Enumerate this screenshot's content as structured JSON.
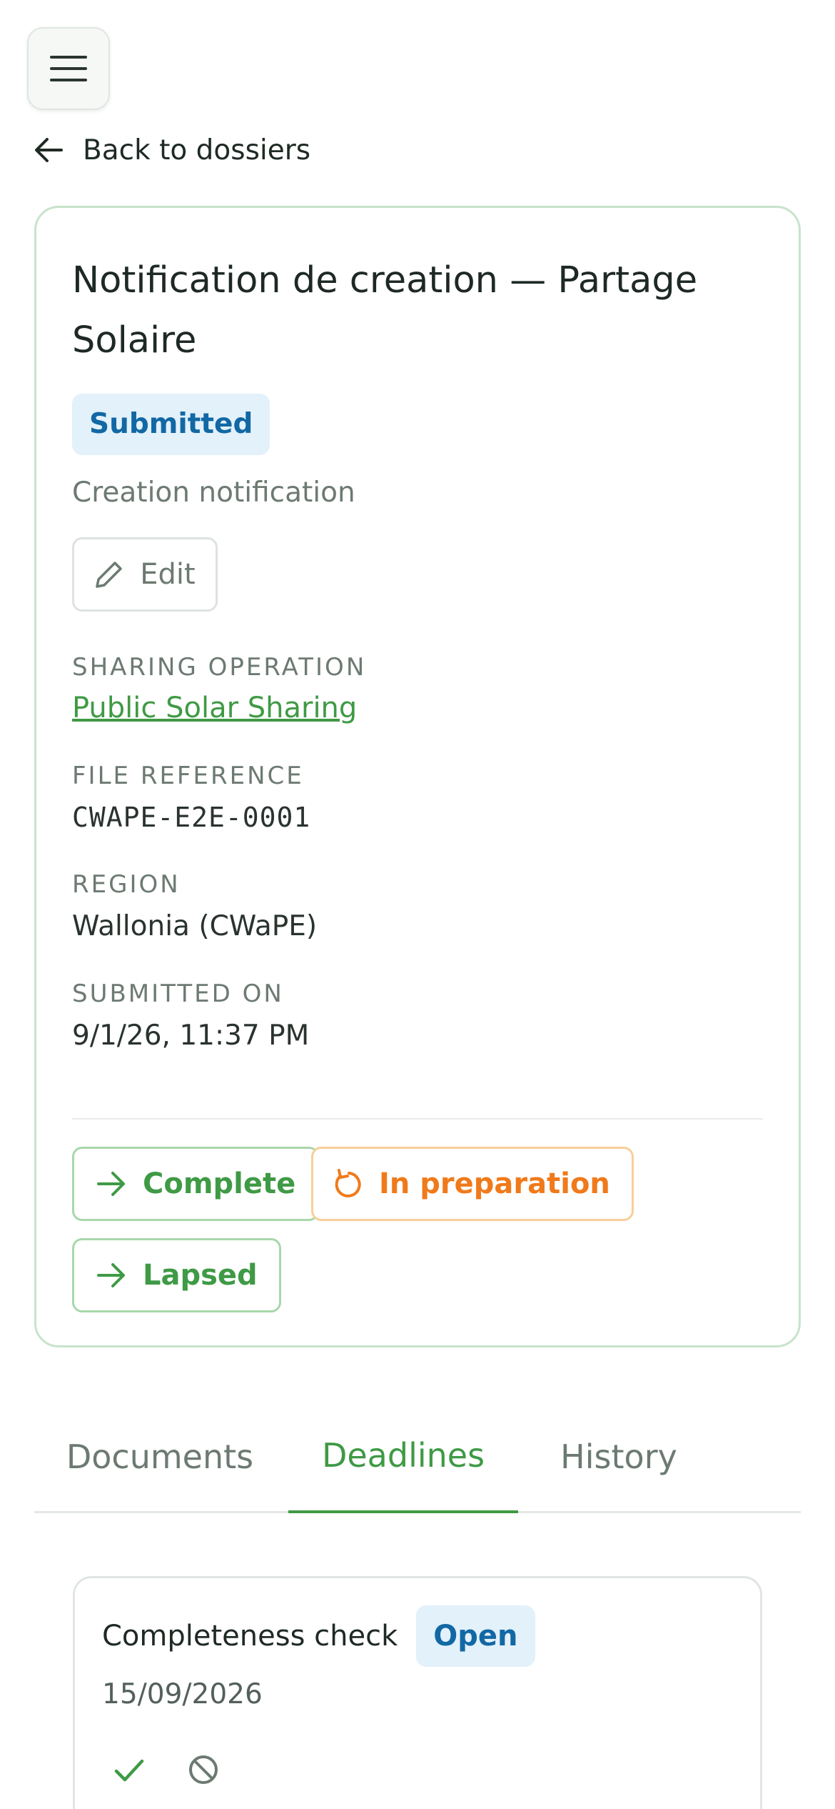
{
  "nav": {
    "back_label": "Back to dossiers"
  },
  "dossier": {
    "title": "Notification de creation — Partage Solaire",
    "status": "Submitted",
    "type": "Creation notification",
    "edit_label": "Edit",
    "fields": [
      {
        "label": "SHARING OPERATION",
        "value": "Public Solar Sharing"
      },
      {
        "label": "FILE REFERENCE",
        "value": "CWAPE-E2E-0001"
      },
      {
        "label": "REGION",
        "value": "Wallonia (CWaPE)"
      },
      {
        "label": "SUBMITTED ON",
        "value": "9/1/26, 11:37 PM"
      }
    ],
    "actions": {
      "complete": "Complete",
      "in_preparation": "In preparation",
      "lapsed": "Lapsed"
    }
  },
  "tabs": [
    "Documents",
    "Deadlines",
    "History"
  ],
  "active_tab": "Deadlines",
  "deadline": {
    "title": "Completeness check",
    "status": "Open",
    "date": "15/09/2026"
  },
  "colors": {
    "accent": "#3f9a45",
    "warning": "#f07a1b",
    "info": "#1268a4"
  }
}
